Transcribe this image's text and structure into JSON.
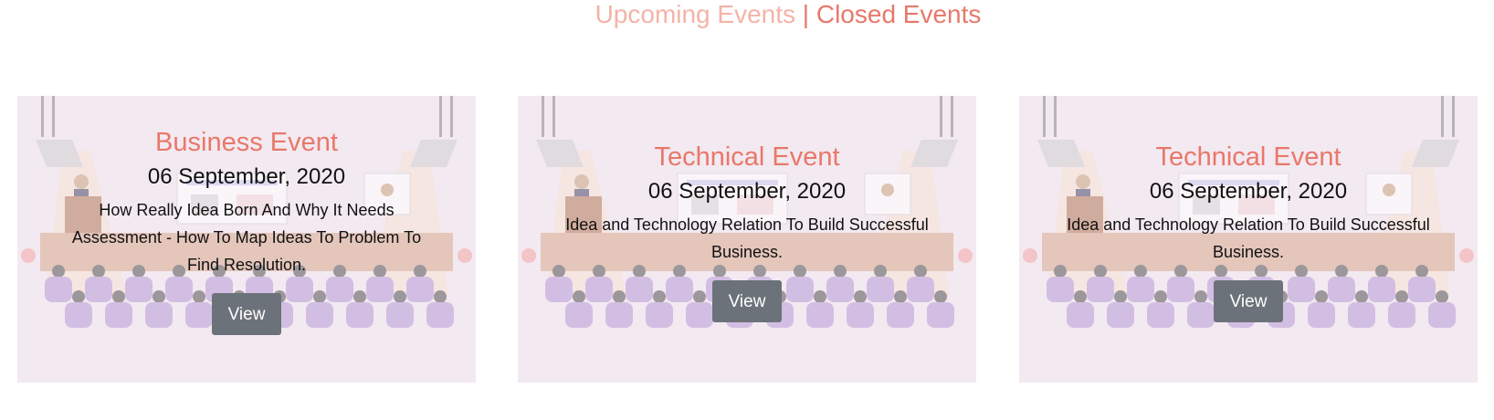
{
  "tabs": {
    "upcoming": "Upcoming Events",
    "separator": "|",
    "closed": "Closed Events"
  },
  "colors": {
    "accent": "#e8786a",
    "accent_light": "#f4b3a8",
    "card_bg": "#f3e9f1",
    "button_bg": "#6c7279"
  },
  "events": [
    {
      "title": "Business Event",
      "date": "06 September, 2020",
      "description": "How Really Idea Born And Why It Needs Assessment - How To Map Ideas To Problem To Find Resolution.",
      "button": "View"
    },
    {
      "title": "Technical Event",
      "date": "06 September, 2020",
      "description": "Idea and Technology Relation To Build Successful Business.",
      "button": "View"
    },
    {
      "title": "Technical Event",
      "date": "06 September, 2020",
      "description": "Idea and Technology Relation To Build Successful Business.",
      "button": "View"
    }
  ]
}
